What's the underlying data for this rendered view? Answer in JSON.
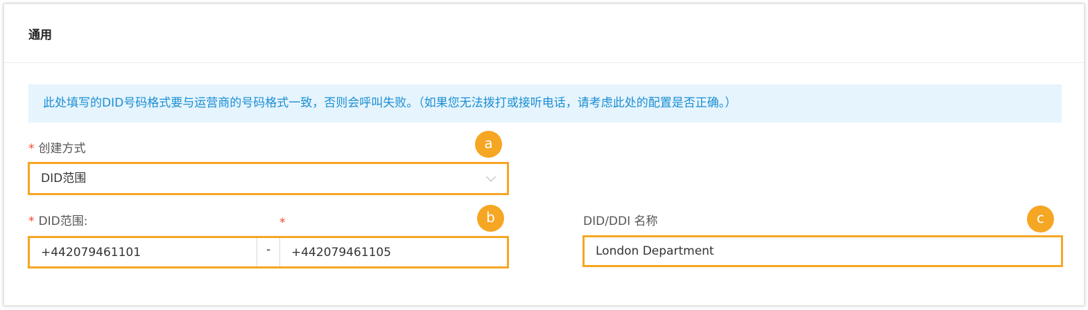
{
  "section": {
    "title": "通用"
  },
  "alert": {
    "text": "此处填写的DID号码格式要与运营商的号码格式一致，否则会呼叫失败。（如果您无法拨打或接听电话，请考虑此处的配置是否正确。）"
  },
  "create_method": {
    "required_mark": "*",
    "label": "创建方式",
    "value": "DID范围",
    "icon": "chevron-down-icon"
  },
  "did_range": {
    "required_mark": "*",
    "label": "DID范围:",
    "end_required_mark": "*",
    "start_value": "+442079461101",
    "separator": "-",
    "end_value": "+442079461105"
  },
  "did_name": {
    "label": "DID/DDI 名称",
    "value": "London Department"
  },
  "badges": {
    "a": "a",
    "b": "b",
    "c": "c"
  },
  "colors": {
    "highlight": "#f5a623",
    "alert_bg": "#e6f4fd",
    "alert_text": "#1a8ed3",
    "required": "#f5452a"
  }
}
